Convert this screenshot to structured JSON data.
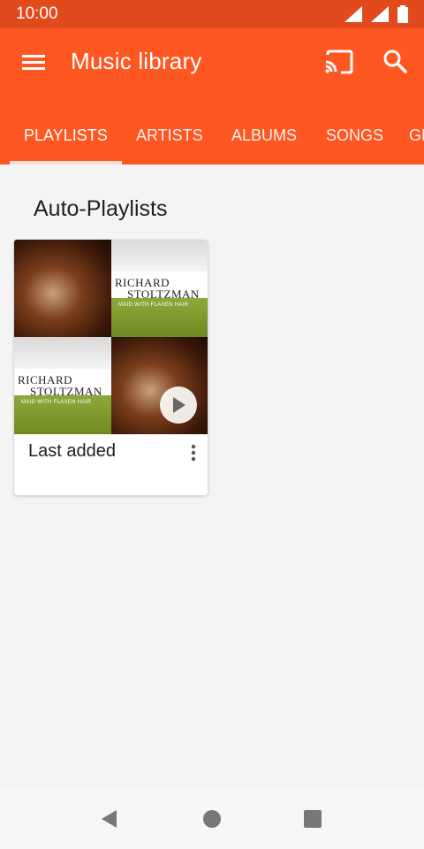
{
  "status_bar": {
    "time": "10:00",
    "icons": [
      "signal-icon",
      "signal-icon",
      "battery-icon"
    ]
  },
  "app_bar": {
    "title": "Music library",
    "icons": [
      "menu-icon",
      "cast-icon",
      "search-icon"
    ],
    "accent_color": "#ff5722"
  },
  "tabs": [
    "PLAYLISTS",
    "ARTISTS",
    "ALBUMS",
    "SONGS",
    "GENRES"
  ],
  "selected_tab": "PLAYLISTS",
  "section": {
    "title": "Auto-Playlists"
  },
  "playlists": [
    {
      "title": "Last added",
      "cover_text": [
        "RICHARD",
        "STOLTZMAN",
        "MAID WITH FLAXEN HAIR"
      ]
    }
  ],
  "nav_bar": {
    "icons": [
      "back-icon",
      "home-icon",
      "recents-icon"
    ]
  }
}
